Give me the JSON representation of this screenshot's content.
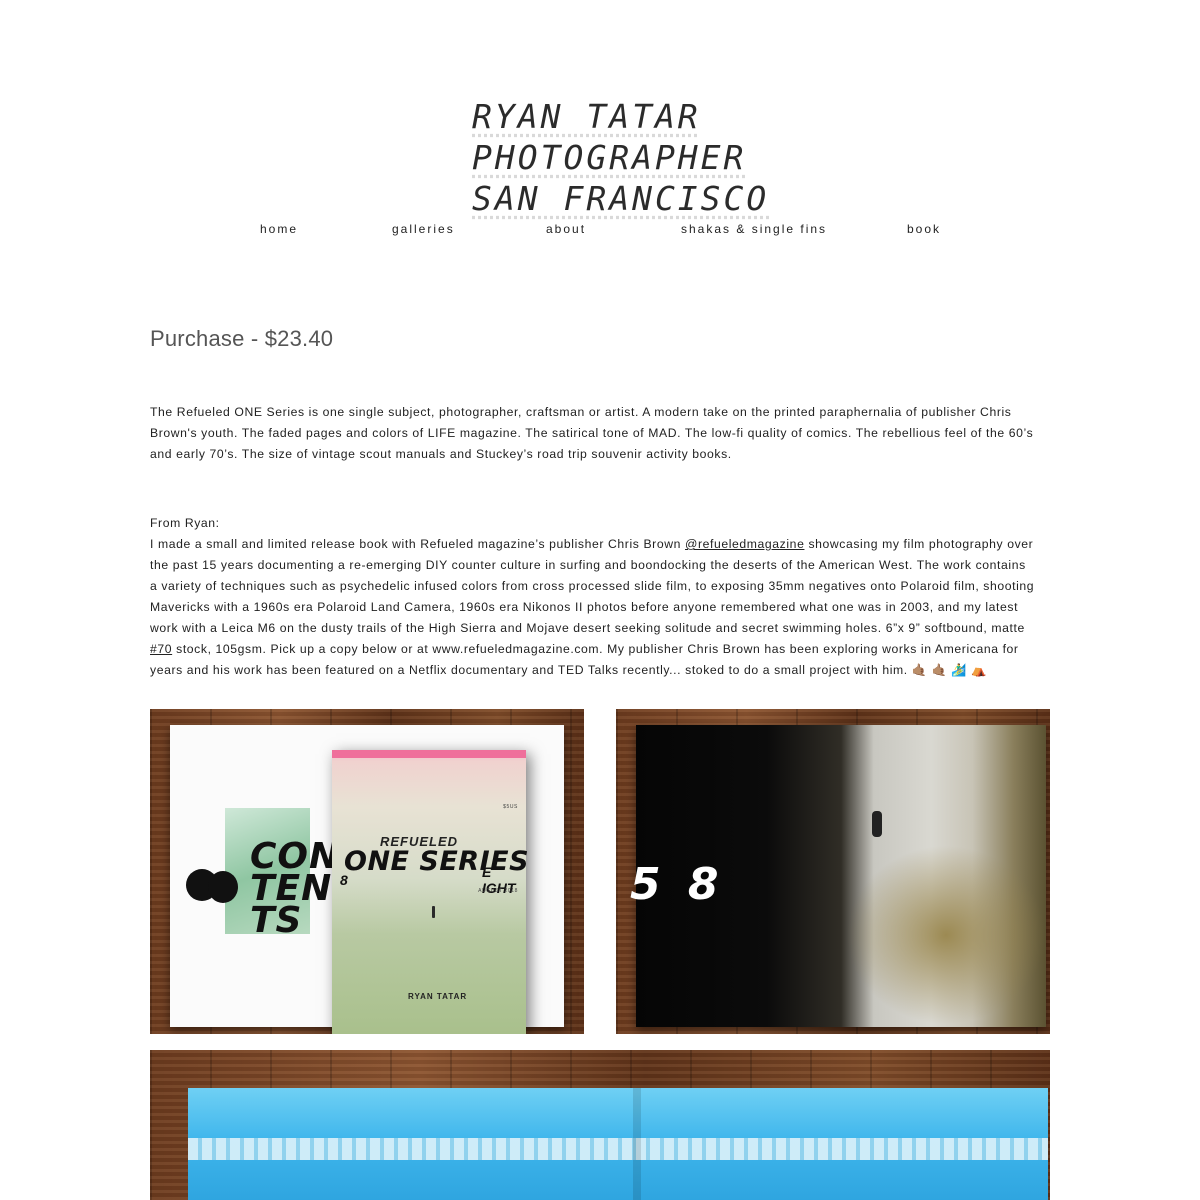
{
  "header": {
    "logo_lines": [
      "RYAN TATAR",
      "PHOTOGRAPHER",
      "SAN FRANCISCO"
    ]
  },
  "nav": {
    "items": [
      {
        "label": "home"
      },
      {
        "label": "galleries"
      },
      {
        "label": "about"
      },
      {
        "label": "shakas & single fins"
      },
      {
        "label": "book"
      }
    ]
  },
  "purchase": {
    "label": "Purchase",
    "separator": " - ",
    "price": "$23.40"
  },
  "description": {
    "intro": "The Refueled ONE Series is one single subject, photographer, craftsman or artist. A modern take on the printed paraphernalia of publisher Chris Brown's youth. The faded pages and colors of LIFE magazine. The satirical tone of MAD. The low-fi quality of comics. The rebellious feel of the 60’s and early 70’s. The size of vintage scout manuals and Stuckey’s road trip souvenir activity books.",
    "from_label": "From Ryan:",
    "body_1": "I made a small and limited release book with Refueled magazine’s publisher Chris Brown ",
    "mention": "@refueledmagazine",
    "body_2": " showcasing my film photography over the past 15 years documenting a re-emerging DIY counter culture in surfing and boondocking the deserts of the American West. The work contains a variety of techniques such as psychedelic infused colors from cross processed slide film, to exposing 35mm negatives onto Polaroid film, shooting Mavericks with a 1960s era Polaroid Land Camera, 1960s era Nikonos II photos before anyone remembered what one was in 2003, and my latest work with a Leica M6 on the dusty trails of the High Sierra and Mojave desert seeking solitude and secret swimming holes. 6”x 9” softbound, matte ",
    "hashtag": "#70",
    "body_3": " stock, 105gsm. Pick up a copy below or at www.refueledmagazine.com. My publisher Chris Brown has been exploring works in Americana for years and his work has been featured on a Netflix documentary and TED Talks recently... stoked to do a small project with him. ",
    "emojis": "🤙🏽 🤙🏽 🏄‍♂️ ⛺"
  },
  "gallery": {
    "photo1": {
      "contents_text": [
        "CON",
        "TEN",
        "TS"
      ],
      "cover_refueled": "REFUELED",
      "cover_title": "ONE SERIES",
      "cover_issue": "E IGHT",
      "cover_author": "RYAN TATAR",
      "cover_price": "$5US",
      "cover_date": "AUGUST 2018",
      "page_number": "8"
    },
    "photo2": {
      "page_numbers": "5 8"
    }
  }
}
